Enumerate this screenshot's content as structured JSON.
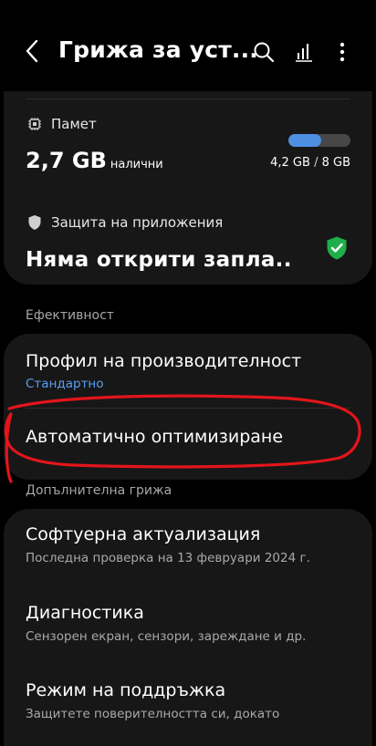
{
  "header": {
    "title": "Грижа за уст...",
    "back_icon": "back-arrow-icon",
    "search_icon": "search-icon",
    "stats_icon": "bar-chart-icon",
    "more_icon": "more-vert-icon"
  },
  "memory": {
    "label": "Памет",
    "icon": "memory-chip-icon",
    "available_value": "2,7 GB",
    "available_label": "налични",
    "used": "4,2 GB",
    "separator": " / ",
    "total": "8 GB",
    "used_fraction": 0.525,
    "bar_color": "#4e8fe2"
  },
  "app_protection": {
    "label": "Защита на приложения",
    "icon": "shield-icon",
    "status": "Няма открити запла..",
    "status_icon": "shield-check-icon",
    "status_color": "#1fae4a"
  },
  "efficiency": {
    "section_title": "Ефективност",
    "items": [
      {
        "title": "Профил на производителност",
        "subtitle": "Стандартно"
      },
      {
        "title": "Автоматично оптимизиране"
      }
    ]
  },
  "extra_care": {
    "section_title": "Допълнителна грижа",
    "items": [
      {
        "title": "Софтуерна актуализация",
        "subtitle": "Последна проверка на 13 февруари 2024 г."
      },
      {
        "title": "Диагностика",
        "subtitle": "Сензорен екран, сензори, зареждане и др."
      },
      {
        "title": "Режим на поддръжка",
        "subtitle": "Защитете поверителността си, докато"
      }
    ]
  },
  "annotation": {
    "color": "#e3151b"
  }
}
